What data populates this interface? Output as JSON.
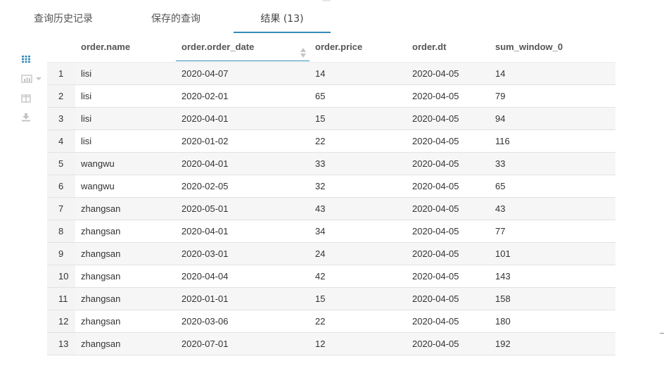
{
  "tabs": [
    {
      "label": "查询历史记录"
    },
    {
      "label": "保存的查询"
    },
    {
      "label": "结果 (13)"
    }
  ],
  "sidebar": {
    "icons": [
      "grid-icon",
      "chart-icon",
      "columns-icon",
      "download-icon"
    ]
  },
  "table": {
    "headers": [
      "order.name",
      "order.order_date",
      "order.price",
      "order.dt",
      "sum_window_0"
    ],
    "rows": [
      [
        "1",
        "lisi",
        "2020-04-07",
        "14",
        "2020-04-05",
        "14"
      ],
      [
        "2",
        "lisi",
        "2020-02-01",
        "65",
        "2020-04-05",
        "79"
      ],
      [
        "3",
        "lisi",
        "2020-04-01",
        "15",
        "2020-04-05",
        "94"
      ],
      [
        "4",
        "lisi",
        "2020-01-02",
        "22",
        "2020-04-05",
        "116"
      ],
      [
        "5",
        "wangwu",
        "2020-04-01",
        "33",
        "2020-04-05",
        "33"
      ],
      [
        "6",
        "wangwu",
        "2020-02-05",
        "32",
        "2020-04-05",
        "65"
      ],
      [
        "7",
        "zhangsan",
        "2020-05-01",
        "43",
        "2020-04-05",
        "43"
      ],
      [
        "8",
        "zhangsan",
        "2020-04-01",
        "34",
        "2020-04-05",
        "77"
      ],
      [
        "9",
        "zhangsan",
        "2020-03-01",
        "24",
        "2020-04-05",
        "101"
      ],
      [
        "10",
        "zhangsan",
        "2020-04-04",
        "42",
        "2020-04-05",
        "143"
      ],
      [
        "11",
        "zhangsan",
        "2020-01-01",
        "15",
        "2020-04-05",
        "158"
      ],
      [
        "12",
        "zhangsan",
        "2020-03-06",
        "22",
        "2020-04-05",
        "180"
      ],
      [
        "13",
        "zhangsan",
        "2020-07-01",
        "12",
        "2020-04-05",
        "192"
      ]
    ]
  },
  "colors": {
    "accent": "#338bb8",
    "icon_active": "#338bb8",
    "icon_inactive": "#c4c4c4"
  }
}
